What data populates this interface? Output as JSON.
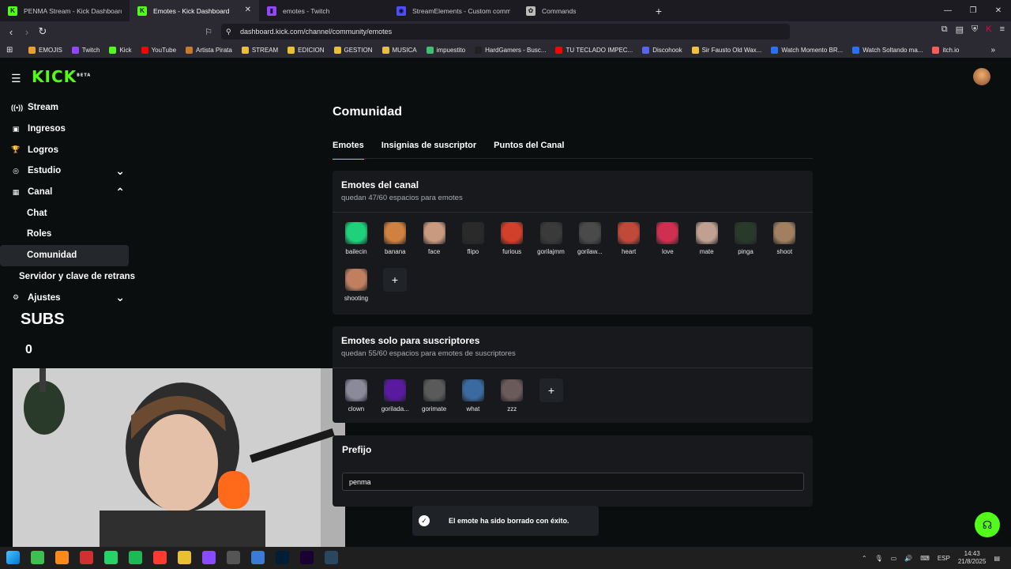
{
  "browser": {
    "tabs": [
      {
        "title": "PENMA Stream - Kick Dashboard",
        "icon": "kick-icon",
        "color": "#53fc18",
        "glyph": "K"
      },
      {
        "title": "Emotes - Kick Dashboard",
        "icon": "kick-icon",
        "color": "#53fc18",
        "glyph": "K"
      },
      {
        "title": "emotes - Twitch",
        "icon": "twitch-icon",
        "color": "#9146ff",
        "glyph": "▮"
      },
      {
        "title": "StreamElements - Custom command",
        "icon": "streamelements-icon",
        "color": "#4e4dff",
        "glyph": "◉"
      },
      {
        "title": "Commands",
        "icon": "commands-icon",
        "color": "#bbbbbb",
        "glyph": "✿"
      }
    ],
    "url": "dashboard.kick.com/channel/community/emotes",
    "bookmarks": [
      {
        "label": "EMOJIS",
        "color": "#e8a030"
      },
      {
        "label": "Twitch",
        "color": "#9146ff"
      },
      {
        "label": "Kick",
        "color": "#53fc18"
      },
      {
        "label": "YouTube",
        "color": "#ff0000"
      },
      {
        "label": "Artista Pirata",
        "color": "#c9792b"
      },
      {
        "label": "STREAM",
        "color": "#e8c030"
      },
      {
        "label": "EDICION",
        "color": "#e8c030"
      },
      {
        "label": "GESTION",
        "color": "#e8c030"
      },
      {
        "label": "MUSICA",
        "color": "#e8c030"
      },
      {
        "label": "impuestito",
        "color": "#3fbf6f"
      },
      {
        "label": "HardGamers - Busc...",
        "color": "#222222"
      },
      {
        "label": "TU TECLADO IMPEC...",
        "color": "#ff0000"
      },
      {
        "label": "Discohook",
        "color": "#5865f2"
      },
      {
        "label": "Sir Fausto Old Wax...",
        "color": "#f0c040"
      },
      {
        "label": "Watch Momento BR...",
        "color": "#2a6fff"
      },
      {
        "label": "Watch Soltando ma...",
        "color": "#2a6fff"
      },
      {
        "label": "itch.io",
        "color": "#fa5c5c"
      }
    ]
  },
  "header": {
    "logo": "KICK",
    "logo_badge": "BETA"
  },
  "sidebar": {
    "items": [
      {
        "label": "Stream",
        "icon": "stream-icon",
        "glyph": "((•))"
      },
      {
        "label": "Ingresos",
        "icon": "income-icon",
        "glyph": "▣"
      },
      {
        "label": "Logros",
        "icon": "trophy-icon",
        "glyph": "🏆"
      },
      {
        "label": "Estudio",
        "icon": "studio-icon",
        "glyph": "◎",
        "chevron": "⌄"
      },
      {
        "label": "Canal",
        "icon": "channel-icon",
        "glyph": "▦",
        "chevron": "⌃"
      },
      {
        "label": "Chat",
        "sub": true
      },
      {
        "label": "Roles",
        "sub": true
      },
      {
        "label": "Comunidad",
        "sub": true,
        "active": true
      },
      {
        "label": "Servidor y clave de retrans",
        "sub2": true
      },
      {
        "label": "Ajustes",
        "icon": "settings-icon",
        "glyph": "⚙",
        "chevron": "⌄"
      }
    ],
    "subs_label": "SUBS",
    "subs_count": "0"
  },
  "main": {
    "title": "Comunidad",
    "tabs": [
      "Emotes",
      "Insignias de suscriptor",
      "Puntos del Canal"
    ],
    "channel_emotes": {
      "title": "Emotes del canal",
      "subtitle": "quedan 47/60 espacios para emotes",
      "items": [
        {
          "name": "bailecin",
          "color": "#1fd17a"
        },
        {
          "name": "banana",
          "color": "#d08040"
        },
        {
          "name": "face",
          "color": "#c99a80"
        },
        {
          "name": "flipo",
          "color": "#2a2a2a"
        },
        {
          "name": "furious",
          "color": "#d0402a"
        },
        {
          "name": "gorilajmm",
          "color": "#3a3a3a"
        },
        {
          "name": "gorilaw...",
          "color": "#4a4a4a"
        },
        {
          "name": "heart",
          "color": "#c04a3a"
        },
        {
          "name": "love",
          "color": "#d03050"
        },
        {
          "name": "mate",
          "color": "#c0a090"
        },
        {
          "name": "pinga",
          "color": "#2a3a2a"
        },
        {
          "name": "shoot",
          "color": "#a08060"
        },
        {
          "name": "shooting",
          "color": "#c08060"
        }
      ]
    },
    "sub_emotes": {
      "title": "Emotes solo para suscriptores",
      "subtitle": "quedan 55/60 espacios para emotes de suscriptores",
      "items": [
        {
          "name": "clown",
          "color": "#8a8a9a"
        },
        {
          "name": "gorilada...",
          "color": "#5a1aa0"
        },
        {
          "name": "gorimate",
          "color": "#5a5a5a"
        },
        {
          "name": "what",
          "color": "#3a6aa0"
        },
        {
          "name": "zzz",
          "color": "#6a5a5a"
        }
      ]
    },
    "prefix_label": "Prefijo",
    "prefix_value": "penma"
  },
  "toast": {
    "message": "El emote ha sido borrado con éxito."
  },
  "taskbar": {
    "lang": "ESP",
    "time": "14:43",
    "date": "21/8/2025",
    "icons": [
      "#3fbf4f",
      "#ff8a1a",
      "#d03030",
      "#25d366",
      "#1db954",
      "#ff3b30",
      "#e8c030",
      "#8a4aff",
      "#555555",
      "#3a7bd5",
      "#001e36",
      "#1a0033",
      "#2a475e"
    ]
  }
}
